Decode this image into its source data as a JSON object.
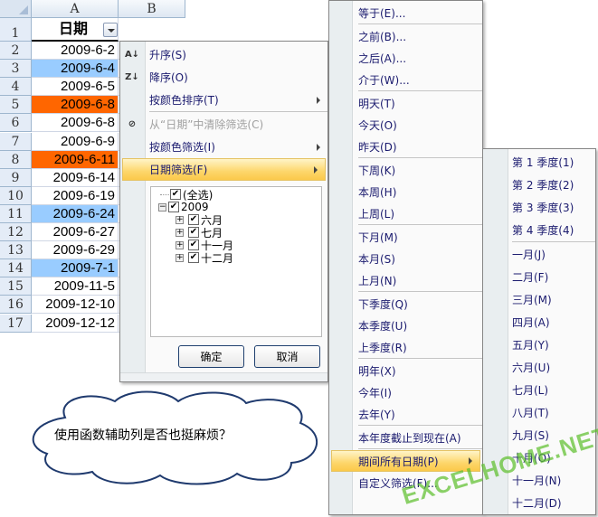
{
  "sheet": {
    "columns": [
      "A",
      "B"
    ],
    "header": "日期",
    "rows": [
      {
        "n": "1"
      },
      {
        "n": "2",
        "v": "2009-6-2",
        "fill": ""
      },
      {
        "n": "3",
        "v": "2009-6-4",
        "fill": "#99ccff"
      },
      {
        "n": "4",
        "v": "2009-6-5",
        "fill": ""
      },
      {
        "n": "5",
        "v": "2009-6-8",
        "fill": "#ff6600"
      },
      {
        "n": "6",
        "v": "2009-6-8",
        "fill": ""
      },
      {
        "n": "7",
        "v": "2009-6-9",
        "fill": ""
      },
      {
        "n": "8",
        "v": "2009-6-11",
        "fill": "#ff6600"
      },
      {
        "n": "9",
        "v": "2009-6-14",
        "fill": ""
      },
      {
        "n": "10",
        "v": "2009-6-19",
        "fill": ""
      },
      {
        "n": "11",
        "v": "2009-6-24",
        "fill": "#99ccff"
      },
      {
        "n": "12",
        "v": "2009-6-27",
        "fill": ""
      },
      {
        "n": "13",
        "v": "2009-6-29",
        "fill": ""
      },
      {
        "n": "14",
        "v": "2009-7-1",
        "fill": "#99ccff"
      },
      {
        "n": "15",
        "v": "2009-11-5",
        "fill": ""
      },
      {
        "n": "16",
        "v": "2009-12-10",
        "fill": ""
      },
      {
        "n": "17",
        "v": "2009-12-12",
        "fill": ""
      }
    ]
  },
  "filter_menu": {
    "items": [
      {
        "label": "升序(S)",
        "icon": "sort-ascending-icon",
        "glyph": "A↓"
      },
      {
        "label": "降序(O)",
        "icon": "sort-descending-icon",
        "glyph": "Z↓"
      },
      {
        "label": "按颜色排序(T)",
        "submenu": true
      },
      {
        "sep": true
      },
      {
        "label": "从“日期”中清除筛选(C)",
        "disabled": true,
        "icon": "clear-filter-icon",
        "glyph": "⊘"
      },
      {
        "label": "按颜色筛选(I)",
        "submenu": true
      },
      {
        "label": "日期筛选(F)",
        "submenu": true,
        "highlight": true
      }
    ],
    "tree": {
      "select_all": "(全选)",
      "year": "2009",
      "months": [
        "六月",
        "七月",
        "十一月",
        "十二月"
      ]
    },
    "ok": "确定",
    "cancel": "取消"
  },
  "date_filter_menu": {
    "items": [
      {
        "label": "等于(E)..."
      },
      {
        "sep": true
      },
      {
        "label": "之前(B)..."
      },
      {
        "label": "之后(A)..."
      },
      {
        "label": "介于(W)..."
      },
      {
        "sep": true
      },
      {
        "label": "明天(T)"
      },
      {
        "label": "今天(O)"
      },
      {
        "label": "昨天(D)"
      },
      {
        "sep": true
      },
      {
        "label": "下周(K)"
      },
      {
        "label": "本周(H)"
      },
      {
        "label": "上周(L)"
      },
      {
        "sep": true
      },
      {
        "label": "下月(M)"
      },
      {
        "label": "本月(S)"
      },
      {
        "label": "上月(N)"
      },
      {
        "sep": true
      },
      {
        "label": "下季度(Q)"
      },
      {
        "label": "本季度(U)"
      },
      {
        "label": "上季度(R)"
      },
      {
        "sep": true
      },
      {
        "label": "明年(X)"
      },
      {
        "label": "今年(I)"
      },
      {
        "label": "去年(Y)"
      },
      {
        "sep": true
      },
      {
        "label": "本年度截止到现在(A)"
      },
      {
        "sep": true
      },
      {
        "label": "期间所有日期(P)",
        "submenu": true,
        "highlight": true
      },
      {
        "label": "自定义筛选(F)..."
      }
    ]
  },
  "period_menu": {
    "items": [
      {
        "label": "第 1 季度(1)"
      },
      {
        "label": "第 2 季度(2)"
      },
      {
        "label": "第 3 季度(3)"
      },
      {
        "label": "第 4 季度(4)"
      },
      {
        "sep": true
      },
      {
        "label": "一月(J)"
      },
      {
        "label": "二月(F)"
      },
      {
        "label": "三月(M)"
      },
      {
        "label": "四月(A)"
      },
      {
        "label": "五月(Y)"
      },
      {
        "label": "六月(U)"
      },
      {
        "label": "七月(L)"
      },
      {
        "label": "八月(T)"
      },
      {
        "label": "九月(S)"
      },
      {
        "label": "十月(O)"
      },
      {
        "label": "十一月(N)"
      },
      {
        "label": "十二月(D)"
      }
    ]
  },
  "callout": "使用函数辅助列是否也挺麻烦？",
  "watermark": "EXCELHOME.NET"
}
